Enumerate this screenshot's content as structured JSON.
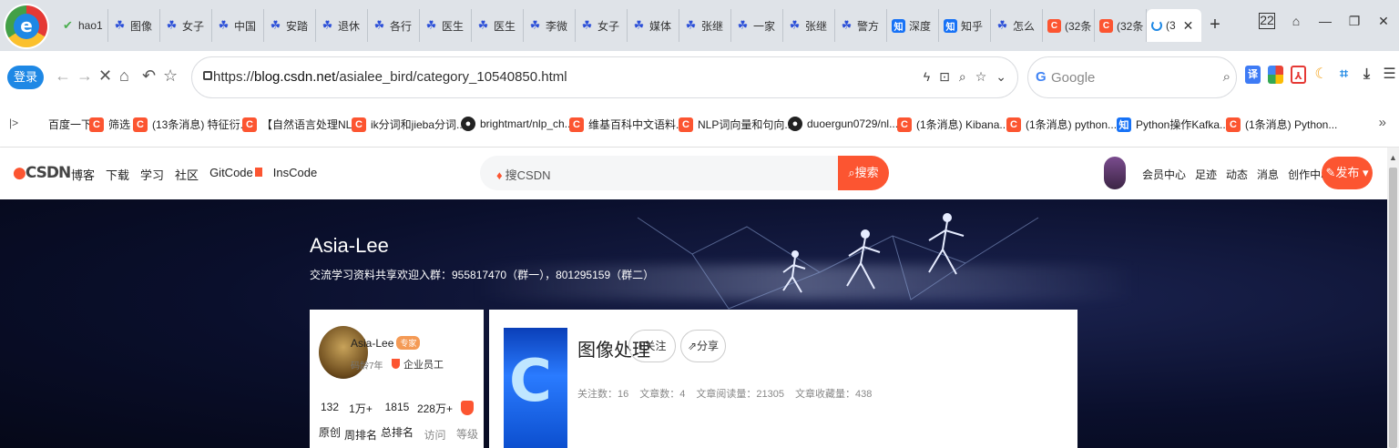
{
  "browser": {
    "login_label": "登录",
    "logo_letter": "e",
    "tabs": [
      {
        "icon": "hao",
        "title": "hao1"
      },
      {
        "icon": "paw",
        "title": "图像"
      },
      {
        "icon": "paw",
        "title": "女子"
      },
      {
        "icon": "paw",
        "title": "中国"
      },
      {
        "icon": "paw",
        "title": "安踏"
      },
      {
        "icon": "paw",
        "title": "退休"
      },
      {
        "icon": "paw",
        "title": "各行"
      },
      {
        "icon": "paw",
        "title": "医生"
      },
      {
        "icon": "paw",
        "title": "医生"
      },
      {
        "icon": "paw",
        "title": "李微"
      },
      {
        "icon": "paw",
        "title": "女子"
      },
      {
        "icon": "paw",
        "title": "媒体"
      },
      {
        "icon": "paw",
        "title": "张继"
      },
      {
        "icon": "paw",
        "title": "一家"
      },
      {
        "icon": "paw",
        "title": "张继"
      },
      {
        "icon": "paw",
        "title": "警方"
      },
      {
        "icon": "zhi",
        "title": "深度"
      },
      {
        "icon": "zhi",
        "title": "知乎"
      },
      {
        "icon": "paw",
        "title": "怎么"
      },
      {
        "icon": "csdn",
        "title": "(32条"
      },
      {
        "icon": "csdn",
        "title": "(32条"
      }
    ],
    "active_tab_title": "(3",
    "tab_count": "22",
    "url_prefix": "https://",
    "url_host": "blog.csdn.net",
    "url_path": "/asialee_bird/category_10540850.html",
    "search_placeholder": "Google",
    "bookmarks": [
      {
        "icon": "paw",
        "title": "百度一下"
      },
      {
        "icon": "csdn",
        "title": "筛选"
      },
      {
        "icon": "csdn",
        "title": "(13条消息) 特征衍..."
      },
      {
        "icon": "csdn",
        "title": "【自然语言处理NL..."
      },
      {
        "icon": "csdn",
        "title": "ik分词和jieba分词..."
      },
      {
        "icon": "gh",
        "title": "brightmart/nlp_ch..."
      },
      {
        "icon": "csdn",
        "title": "维基百科中文语料..."
      },
      {
        "icon": "csdn",
        "title": "NLP词向量和句向..."
      },
      {
        "icon": "gh",
        "title": "duoergun0729/nl..."
      },
      {
        "icon": "csdn",
        "title": "(1条消息) Kibana..."
      },
      {
        "icon": "csdn",
        "title": "(1条消息) python..."
      },
      {
        "icon": "zhi",
        "title": "Python操作Kafka..."
      },
      {
        "icon": "csdn",
        "title": "(1条消息) Python..."
      }
    ]
  },
  "csdn": {
    "logo": "CSDN",
    "nav": [
      "博客",
      "下载",
      "学习",
      "社区",
      "GitCode",
      "InsCode"
    ],
    "search_placeholder": "搜CSDN",
    "search_button": "搜索",
    "right_links": [
      "会员中心",
      "足迹",
      "动态",
      "消息",
      "创作中心"
    ],
    "publish_button": "发布"
  },
  "banner": {
    "name": "Asia-Lee",
    "description": "交流学习资料共享欢迎入群：955817470（群一），801295159（群二）"
  },
  "profile": {
    "name": "Asia-Lee",
    "badge": "专家",
    "code_age": "码龄7年",
    "corp": "企业员工",
    "stats": [
      {
        "value": "132",
        "label": "原创"
      },
      {
        "value": "1万+",
        "label": "周排名"
      },
      {
        "value": "1815",
        "label": "总排名"
      },
      {
        "value": "228万+",
        "label": "访问"
      },
      {
        "value": "",
        "label": "等级"
      }
    ]
  },
  "category": {
    "title": "图像处理",
    "follow_label": "+关注",
    "share_label": "分享",
    "stats": [
      "关注数：16",
      "文章数：4",
      "文章阅读量：21305",
      "文章收藏量：438"
    ]
  }
}
